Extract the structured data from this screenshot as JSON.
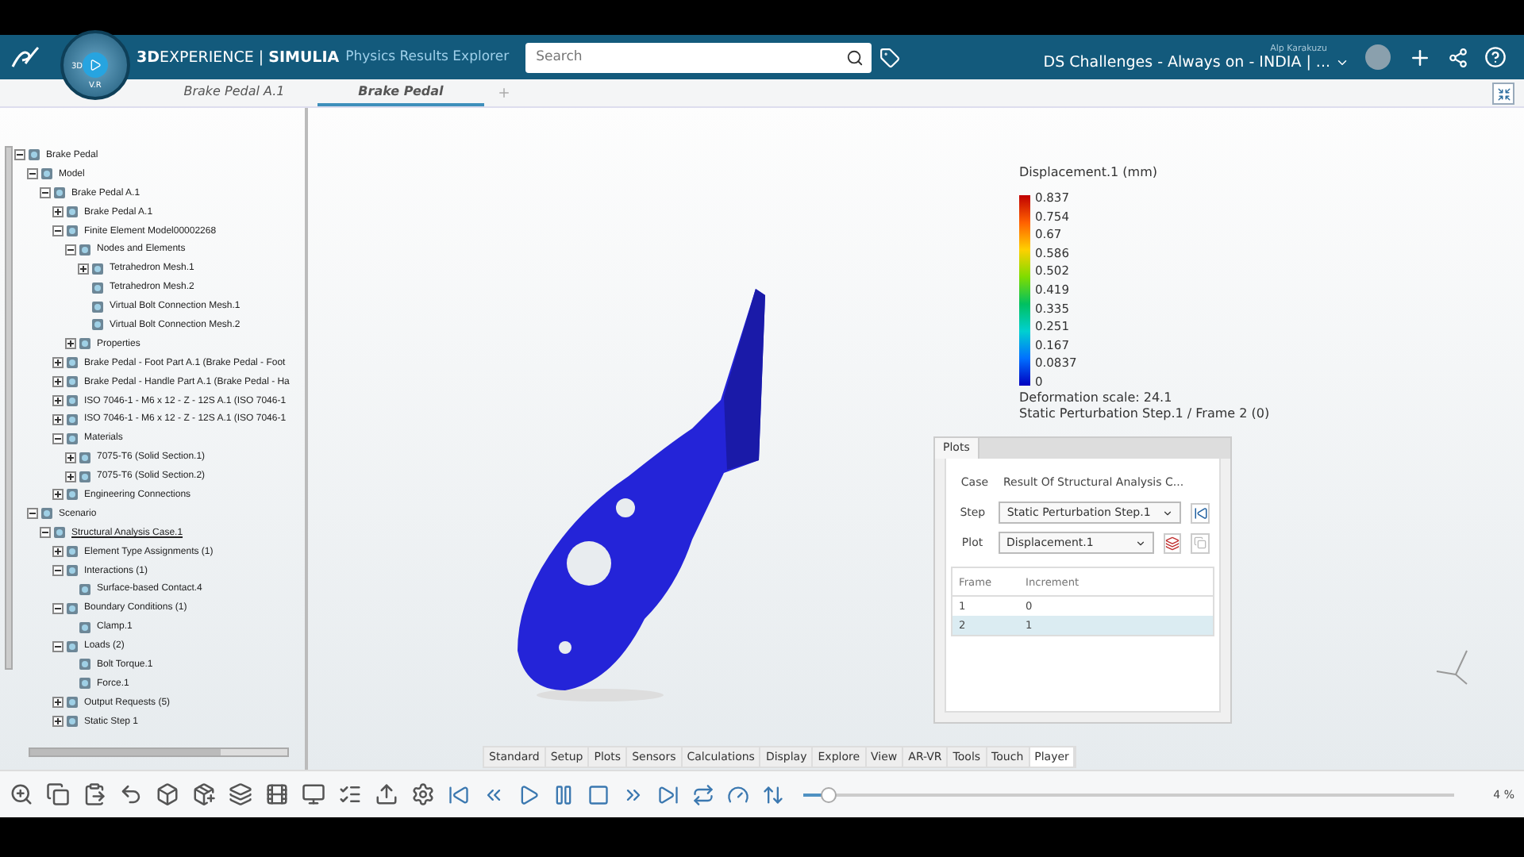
{
  "header": {
    "compass": {
      "left": "3D",
      "bottom": "V.R"
    },
    "brand": "**3D**EXPERIENCE | **SIMULIA**",
    "app": "Physics Results Explorer",
    "search": {
      "placeholder": "Search"
    },
    "user": "Alp Karakuzu",
    "space": "DS Challenges - Always on - INDIA | ..."
  },
  "tabs": [
    {
      "label": "Brake Pedal A.1",
      "selected": false
    },
    {
      "label": "Brake Pedal",
      "selected": true
    }
  ],
  "tree": [
    {
      "label": "Brake Pedal",
      "expanded": true,
      "children": [
        {
          "label": "Model",
          "expanded": true,
          "children": [
            {
              "label": "Brake Pedal A.1",
              "expanded": true,
              "children": [
                {
                  "label": "Brake Pedal A.1",
                  "expanded": false
                },
                {
                  "label": "Finite Element Model00002268",
                  "expanded": true,
                  "children": [
                    {
                      "label": "Nodes and Elements",
                      "expanded": true,
                      "children": [
                        {
                          "label": "Tetrahedron Mesh.1",
                          "expanded": false
                        },
                        {
                          "label": "Tetrahedron Mesh.2"
                        },
                        {
                          "label": "Virtual Bolt Connection Mesh.1"
                        },
                        {
                          "label": "Virtual Bolt Connection Mesh.2"
                        }
                      ]
                    },
                    {
                      "label": "Properties",
                      "expanded": false
                    }
                  ]
                },
                {
                  "label": "Brake Pedal - Foot Part A.1 (Brake Pedal - Foot",
                  "expanded": false
                },
                {
                  "label": "Brake Pedal - Handle Part A.1 (Brake Pedal - Ha",
                  "expanded": false
                },
                {
                  "label": "ISO 7046-1 - M6 x 12 - Z - 12S A.1 (ISO 7046-1",
                  "expanded": false
                },
                {
                  "label": "ISO 7046-1 - M6 x 12 - Z - 12S A.1 (ISO 7046-1",
                  "expanded": false
                },
                {
                  "label": "Materials",
                  "expanded": true,
                  "children": [
                    {
                      "label": "7075-T6 (Solid Section.1)",
                      "expanded": false
                    },
                    {
                      "label": "7075-T6 (Solid Section.2)",
                      "expanded": false
                    }
                  ]
                },
                {
                  "label": "Engineering Connections",
                  "expanded": false
                }
              ]
            }
          ]
        },
        {
          "label": "Scenario",
          "expanded": true,
          "children": [
            {
              "label": "Structural Analysis Case.1",
              "expanded": true,
              "current": true,
              "children": [
                {
                  "label": "Element Type Assignments (1)",
                  "expanded": false
                },
                {
                  "label": "Interactions (1)",
                  "expanded": true,
                  "children": [
                    {
                      "label": "Surface-based Contact.4"
                    }
                  ]
                },
                {
                  "label": "Boundary Conditions (1)",
                  "expanded": true,
                  "children": [
                    {
                      "label": "Clamp.1"
                    }
                  ]
                },
                {
                  "label": "Loads (2)",
                  "expanded": true,
                  "children": [
                    {
                      "label": "Bolt Torque.1"
                    },
                    {
                      "label": "Force.1"
                    }
                  ]
                },
                {
                  "label": "Output Requests (5)",
                  "expanded": false
                },
                {
                  "label": "Static Step 1",
                  "expanded": false
                }
              ]
            }
          ]
        }
      ]
    }
  ],
  "legend": {
    "title": "Displacement.1 (mm)",
    "values": [
      "0.837",
      "0.754",
      "0.67",
      "0.586",
      "0.502",
      "0.419",
      "0.335",
      "0.251",
      "0.167",
      "0.0837",
      "0"
    ],
    "notes": [
      "Deformation scale: 24.1",
      "Static Perturbation Step.1 / Frame 2 (0)"
    ]
  },
  "plots_panel": {
    "tab": "Plots",
    "case": {
      "label": "Case",
      "value": "Result Of Structural Analysis C..."
    },
    "step": {
      "label": "Step",
      "value": "Static Perturbation Step.1"
    },
    "plot": {
      "label": "Plot",
      "value": "Displacement.1"
    },
    "columns": [
      "Frame",
      "Increment"
    ],
    "rows": [
      {
        "cells": [
          "1",
          "0"
        ],
        "selected": false
      },
      {
        "cells": [
          "2",
          "1"
        ],
        "selected": true
      }
    ]
  },
  "toolbar_tabs": [
    {
      "label": "Standard",
      "selected": false
    },
    {
      "label": "Setup",
      "selected": false
    },
    {
      "label": "Plots",
      "selected": false
    },
    {
      "label": "Sensors",
      "selected": false
    },
    {
      "label": "Calculations",
      "selected": false
    },
    {
      "label": "Display",
      "selected": false
    },
    {
      "label": "Explore",
      "selected": false
    },
    {
      "label": "View",
      "selected": false
    },
    {
      "label": "AR-VR",
      "selected": false
    },
    {
      "label": "Tools",
      "selected": false
    },
    {
      "label": "Touch",
      "selected": false
    },
    {
      "label": "Player",
      "selected": true
    }
  ],
  "player": {
    "level": 0.04,
    "reading": "4 %"
  }
}
